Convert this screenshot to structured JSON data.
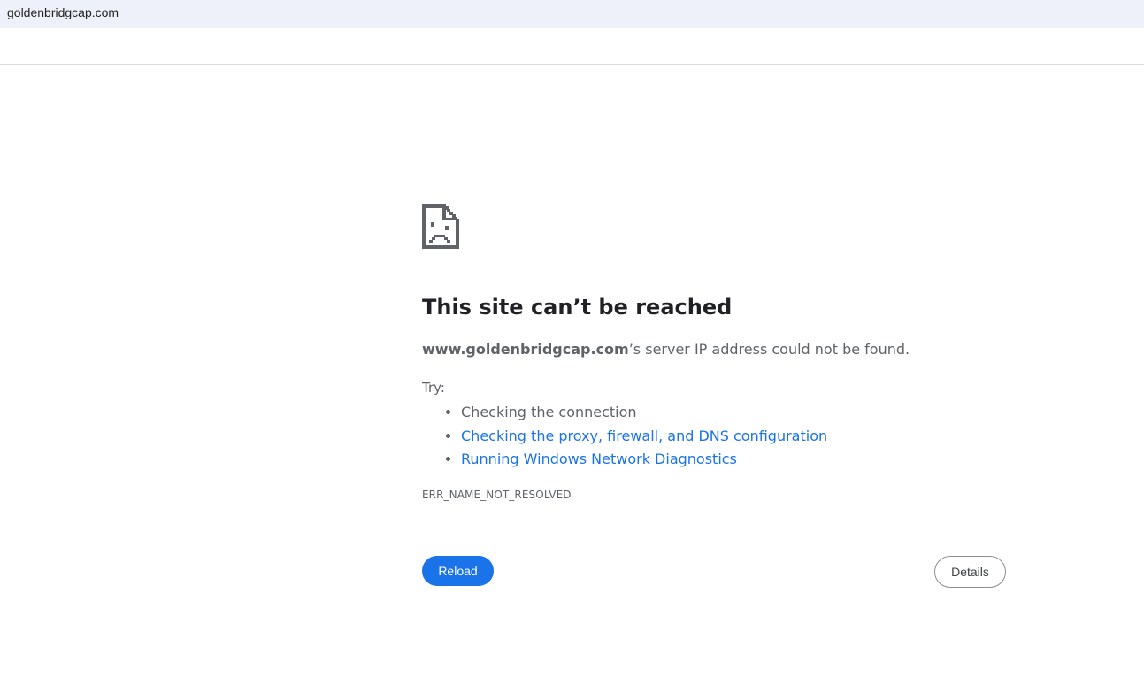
{
  "browser": {
    "url": "goldenbridgcap.com"
  },
  "error": {
    "icon": "sad-page-icon",
    "title": "This site can’t be reached",
    "host": "www.goldenbridgcap.com",
    "summary_suffix": "’s server IP address could not be found.",
    "try_label": "Try:",
    "suggestions": [
      {
        "label": "Checking the connection",
        "link": false
      },
      {
        "label": "Checking the proxy, firewall, and DNS configuration",
        "link": true
      },
      {
        "label": "Running Windows Network Diagnostics",
        "link": true
      }
    ],
    "code": "ERR_NAME_NOT_RESOLVED"
  },
  "buttons": {
    "reload": "Reload",
    "details": "Details"
  },
  "colors": {
    "accent": "#1a73e8",
    "text": "#5f6368",
    "heading": "#202124",
    "url_bar": "#eef1fa"
  }
}
